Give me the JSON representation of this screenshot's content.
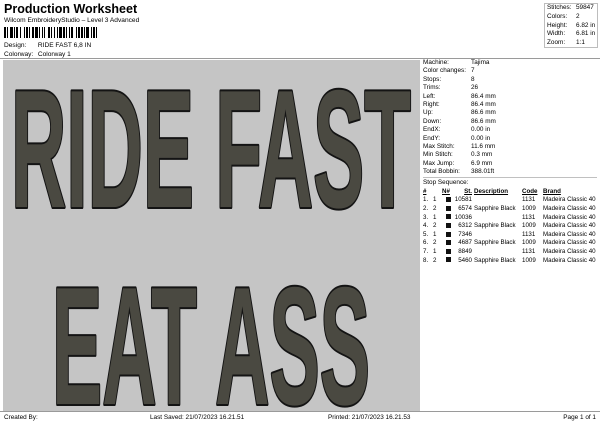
{
  "header": {
    "title": "Production Worksheet",
    "subtitle": "Wilcom EmbroideryStudio – Level 3 Advanced",
    "design_label": "Design:",
    "design_value": "RIDE FAST 6,8 IN",
    "colorway_label": "Colorway:",
    "colorway_value": "Colorway 1"
  },
  "summary": [
    {
      "label": "Stitches:",
      "value": "59847"
    },
    {
      "label": "Colors:",
      "value": "2"
    },
    {
      "label": "Height:",
      "value": "6.82 in"
    },
    {
      "label": "Width:",
      "value": "6.81 in"
    },
    {
      "label": "Zoom:",
      "value": "1:1"
    }
  ],
  "design_text": {
    "line1": "RIDE FAST",
    "line2": "EAT ASS"
  },
  "colors": {
    "canvas_bg": "#c5c5c5",
    "thread_fill": "#4a4941",
    "thread_outline": "#141414"
  },
  "info": [
    {
      "label": "Machine:",
      "value": "Tajima"
    },
    {
      "label": "Color changes:",
      "value": "7"
    },
    {
      "label": "Stops:",
      "value": "8"
    },
    {
      "label": "Trims:",
      "value": "26"
    },
    {
      "label": "Left:",
      "value": "86.4 mm"
    },
    {
      "label": "Right:",
      "value": "86.4 mm"
    },
    {
      "label": "Up:",
      "value": "86.6 mm"
    },
    {
      "label": "Down:",
      "value": "86.6 mm"
    },
    {
      "label": "EndX:",
      "value": "0.00 in"
    },
    {
      "label": "EndY:",
      "value": "0.00 in"
    },
    {
      "label": "Max Stitch:",
      "value": "11.6 mm"
    },
    {
      "label": "Min Stitch:",
      "value": "0.3 mm"
    },
    {
      "label": "Max Jump:",
      "value": "6.9 mm"
    },
    {
      "label": "Total Bobbin:",
      "value": "388.01ft"
    }
  ],
  "stop_sequence": {
    "title": "Stop Sequence:",
    "headers": [
      "#",
      "N#",
      "St.",
      "Description",
      "Code",
      "Brand"
    ],
    "rows": [
      {
        "num": "1.",
        "n": "1",
        "st": "10581",
        "desc": "",
        "code": "1131",
        "brand": "Madeira Classic 40"
      },
      {
        "num": "2.",
        "n": "2",
        "st": "6574",
        "desc": "Sapphire Black",
        "code": "1009",
        "brand": "Madeira Classic 40"
      },
      {
        "num": "3.",
        "n": "1",
        "st": "10036",
        "desc": "",
        "code": "1131",
        "brand": "Madeira Classic 40"
      },
      {
        "num": "4.",
        "n": "2",
        "st": "6312",
        "desc": "Sapphire Black",
        "code": "1009",
        "brand": "Madeira Classic 40"
      },
      {
        "num": "5.",
        "n": "1",
        "st": "7346",
        "desc": "",
        "code": "1131",
        "brand": "Madeira Classic 40"
      },
      {
        "num": "6.",
        "n": "2",
        "st": "4687",
        "desc": "Sapphire Black",
        "code": "1009",
        "brand": "Madeira Classic 40"
      },
      {
        "num": "7.",
        "n": "1",
        "st": "8849",
        "desc": "",
        "code": "1131",
        "brand": "Madeira Classic 40"
      },
      {
        "num": "8.",
        "n": "2",
        "st": "5460",
        "desc": "Sapphire Black",
        "code": "1009",
        "brand": "Madeira Classic 40"
      }
    ]
  },
  "footer": {
    "created_by": "Created By:",
    "last_saved": "Last Saved: 21/07/2023 16.21.51",
    "printed": "Printed: 21/07/2023 16.21.53",
    "page": "Page 1 of 1"
  }
}
